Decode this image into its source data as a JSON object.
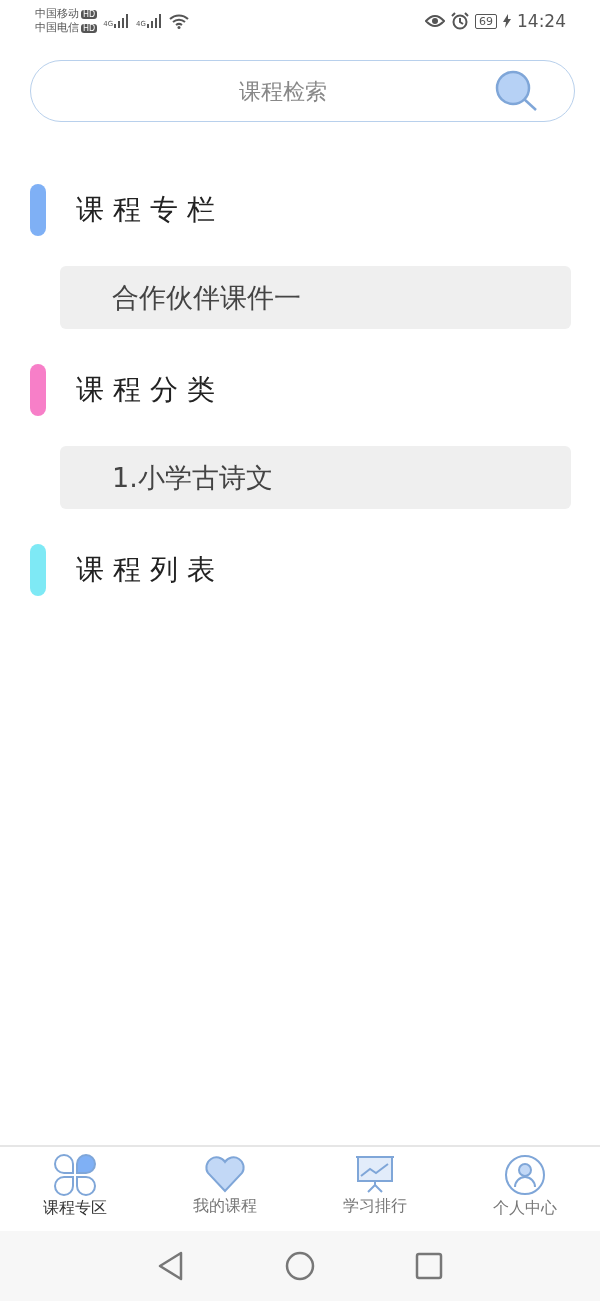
{
  "status_bar": {
    "carriers": [
      {
        "name": "中国移动",
        "badge": "HD"
      },
      {
        "name": "中国电信",
        "badge": "HD"
      }
    ],
    "signals": [
      "4G",
      "4G"
    ],
    "battery": "69",
    "time": "14:24"
  },
  "search": {
    "placeholder": "课程检索"
  },
  "sections": [
    {
      "title": "课程专栏",
      "color": "#7fb0f5",
      "items": [
        "合作伙伴课件一"
      ]
    },
    {
      "title": "课程分类",
      "color": "#f77fc8",
      "items": [
        "1.小学古诗文"
      ]
    },
    {
      "title": "课程列表",
      "color": "#7ee9f5"
    }
  ],
  "tabs": [
    {
      "label": "课程专区",
      "selected": true
    },
    {
      "label": "我的课程",
      "selected": false
    },
    {
      "label": "学习排行",
      "selected": false
    },
    {
      "label": "个人中心",
      "selected": false
    }
  ]
}
